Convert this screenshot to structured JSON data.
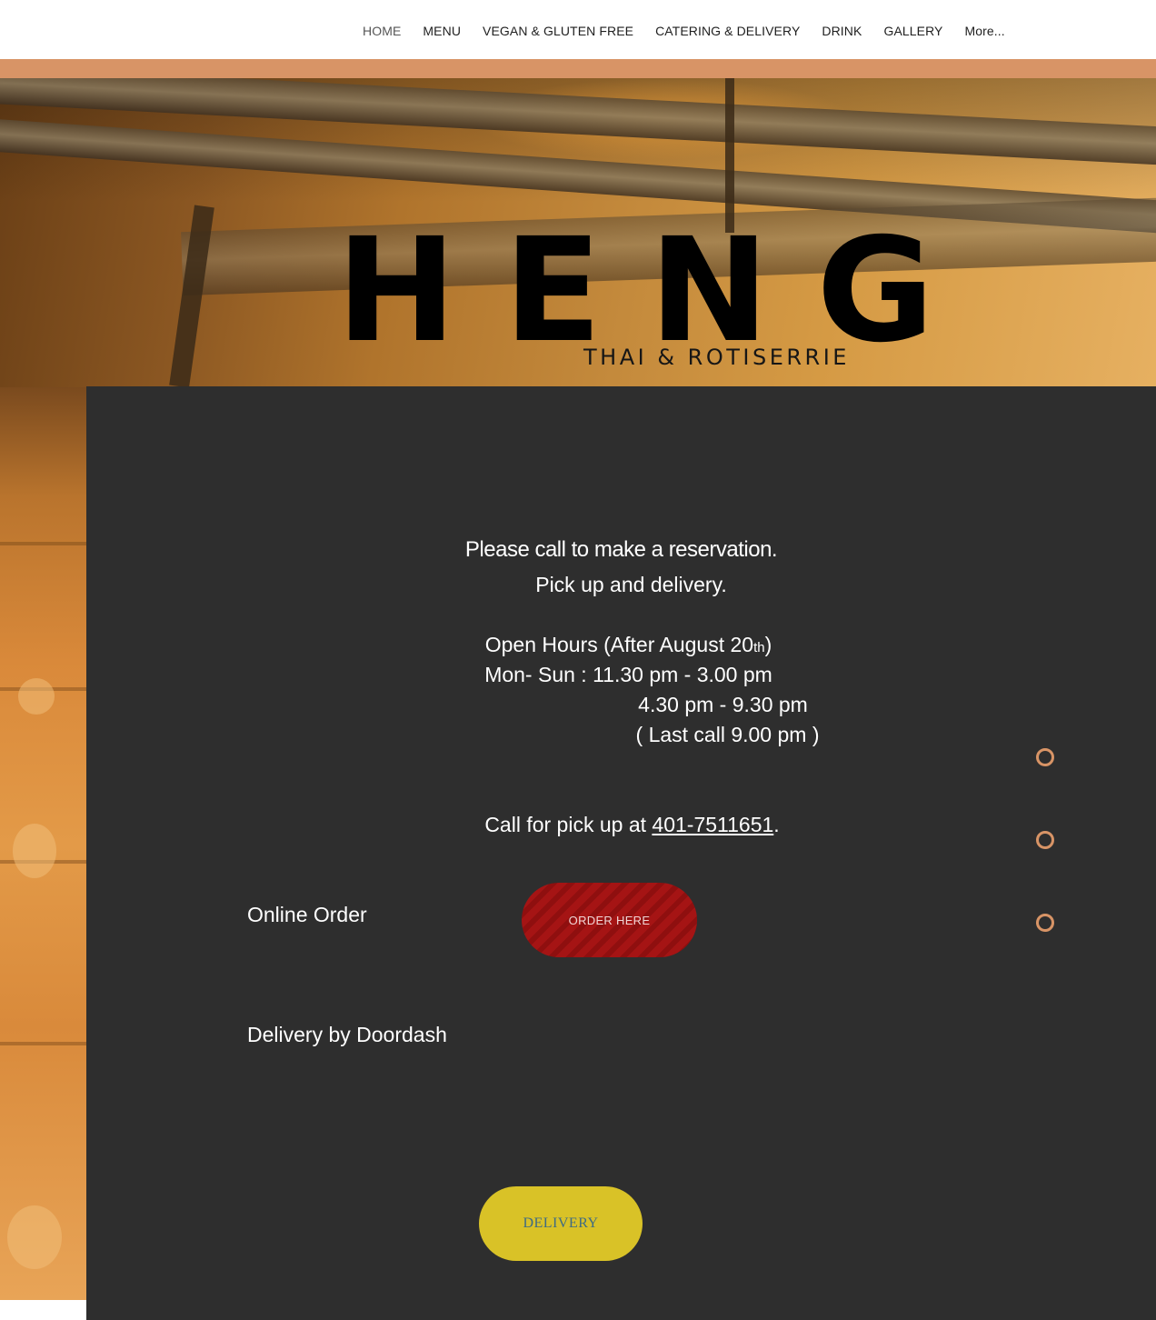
{
  "nav": {
    "items": [
      {
        "label": "HOME"
      },
      {
        "label": "MENU"
      },
      {
        "label": "VEGAN & GLUTEN FREE"
      },
      {
        "label": "CATERING & DELIVERY"
      },
      {
        "label": "DRINK"
      },
      {
        "label": "GALLERY"
      },
      {
        "label": "More..."
      }
    ]
  },
  "brand": {
    "name": "HENG",
    "tagline": "THAI & ROTISERRIE"
  },
  "info": {
    "reservation": "Please call to make a reservation.",
    "pickup": "Pick up and delivery.",
    "hours_title_pre": "Open Hours (After August 20",
    "hours_title_sup": "th",
    "hours_title_post": ")",
    "hours_line1": "Mon- Sun : 11.30 pm - 3.00 pm",
    "hours_line2": "4.30 pm - 9.30 pm",
    "hours_line3": "( Last call 9.00 pm )",
    "call_pre": "Call for pick up at ",
    "phone": "401-7511651",
    "call_post": "."
  },
  "order": {
    "label": "Online Order",
    "button": "ORDER HERE"
  },
  "delivery": {
    "label": "Delivery by Doordash",
    "button": "DELIVERY"
  },
  "colors": {
    "accent": "#d89466",
    "panel": "#2e2e2e",
    "order_button": "#a51414",
    "delivery_button": "#d9c227"
  }
}
